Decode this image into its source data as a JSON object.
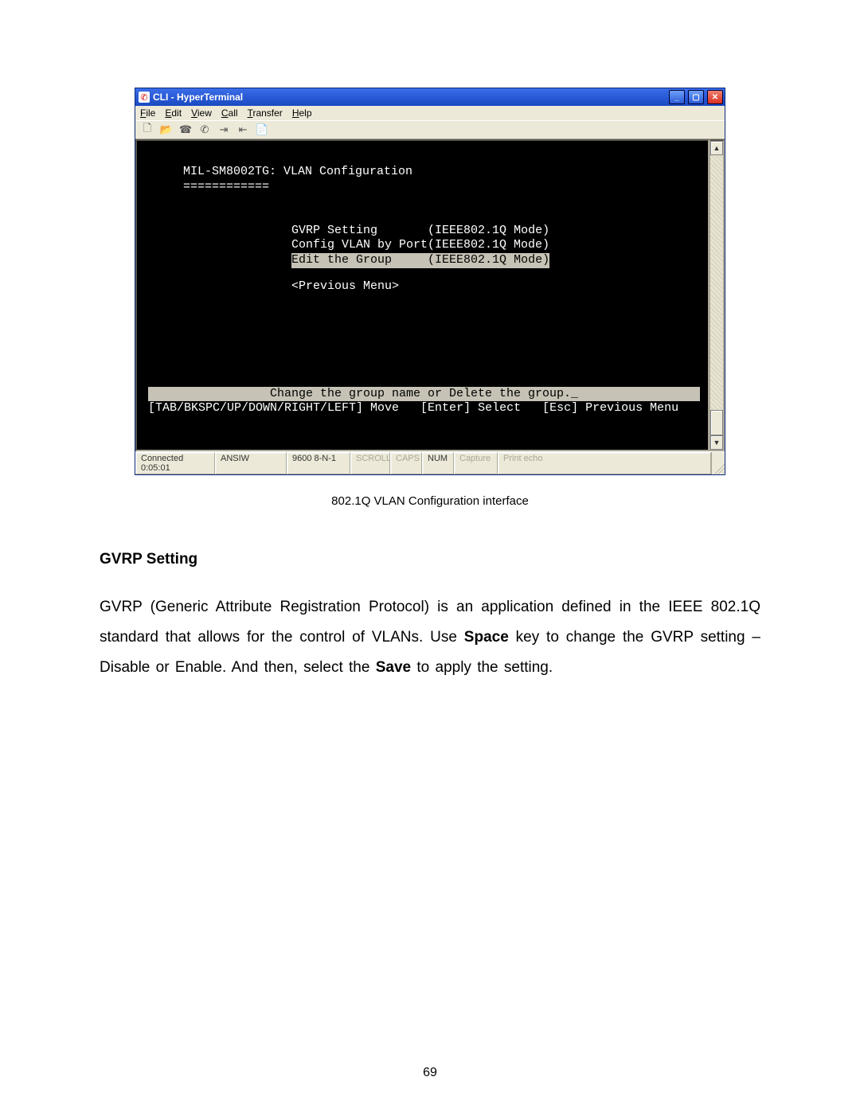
{
  "window": {
    "title": "CLI - HyperTerminal",
    "menus": [
      "File",
      "Edit",
      "View",
      "Call",
      "Transfer",
      "Help"
    ]
  },
  "terminal": {
    "header": "MIL-SM8002TG: VLAN Configuration",
    "underline": "============",
    "items": [
      {
        "label": "GVRP Setting",
        "mode": "(IEEE802.1Q Mode)",
        "selected": false
      },
      {
        "label": "Config VLAN by Port",
        "mode": "(IEEE802.1Q Mode)",
        "selected": false
      },
      {
        "label": "Edit the Group",
        "mode": "(IEEE802.1Q Mode)",
        "selected": true
      },
      {
        "label": "<Previous Menu>",
        "mode": "",
        "selected": false
      }
    ],
    "hint": "Change the group name or Delete the group._",
    "nav": "[TAB/BKSPC/UP/DOWN/RIGHT/LEFT] Move   [Enter] Select   [Esc] Previous Menu"
  },
  "status": {
    "conn": "Connected 0:05:01",
    "emul": "ANSIW",
    "baud": "9600 8-N-1",
    "scroll": "SCROLL",
    "caps": "CAPS",
    "num": "NUM",
    "capture": "Capture",
    "echo": "Print echo"
  },
  "figure_caption": "802.1Q VLAN Configuration interface",
  "section_heading": "GVRP Setting",
  "paragraph": {
    "p1a": "GVRP (Generic Attribute Registration Protocol) is an application defined in the IEEE 802.1Q standard that allows for the control of VLANs. Use ",
    "space": "Space",
    "p1b": " key to change the GVRP setting – Disable or Enable. And then, select the ",
    "save": "Save",
    "p1c": " to apply the setting."
  },
  "page_number": "69"
}
